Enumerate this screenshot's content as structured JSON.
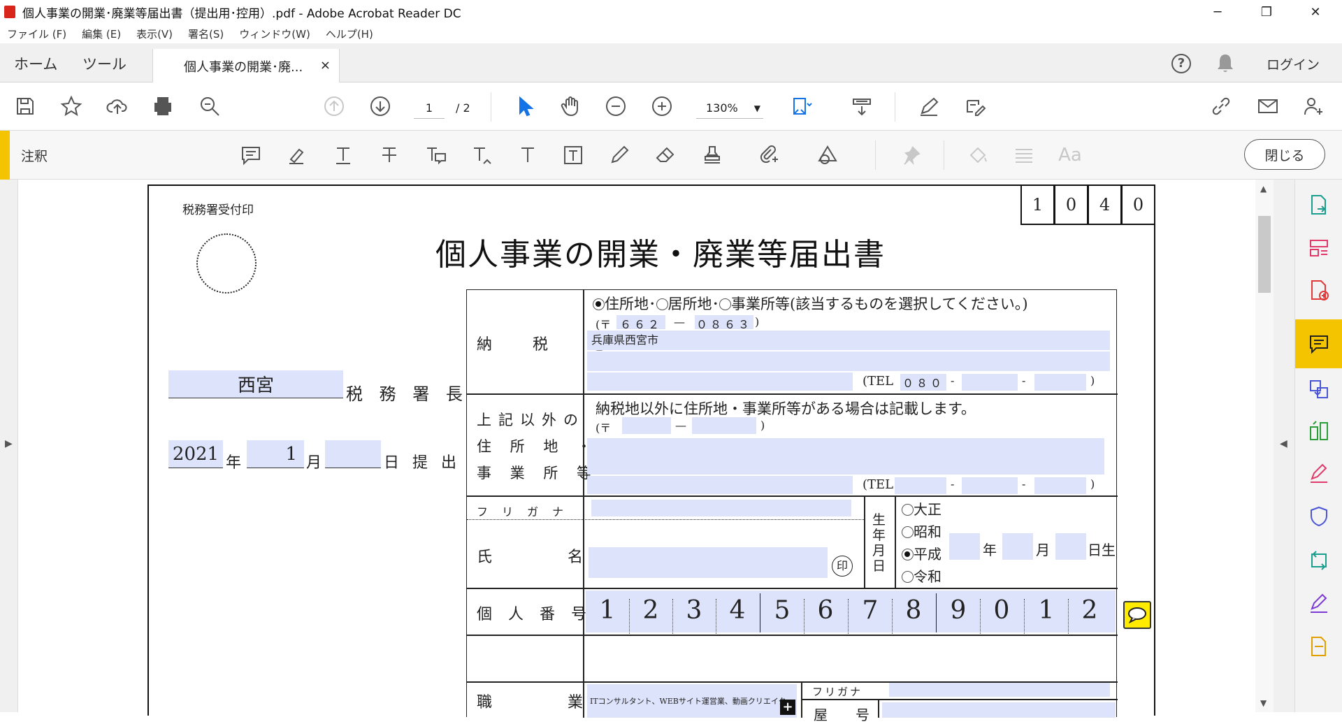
{
  "window": {
    "title": "個人事業の開業･廃業等届出書（提出用･控用）.pdf - Adobe Acrobat Reader DC",
    "minimize": "─",
    "maximize": "❐",
    "close": "✕"
  },
  "menu": [
    "ファイル (F)",
    "編集 (E)",
    "表示(V)",
    "署名(S)",
    "ウィンドウ(W)",
    "ヘルプ(H)"
  ],
  "tabs": {
    "home": "ホーム",
    "tools": "ツール",
    "doc": "個人事業の開業･廃...",
    "doc_close": "×",
    "login": "ログイン"
  },
  "toolbar": {
    "page_current": "1",
    "page_total": "/ 2",
    "zoom": "130%"
  },
  "comment_bar": {
    "label": "注釈",
    "close": "閉じる"
  },
  "form": {
    "stamp_label": "税務署受付印",
    "title": "個人事業の開業・廃業等届出書",
    "code_digits": [
      "1",
      "0",
      "4",
      "0"
    ],
    "tax_office_value": "西宮",
    "tax_office_label": "税 務 署 長",
    "date_year": "2021",
    "date_year_l": "年",
    "date_month": "1",
    "date_month_l": "月",
    "date_day": "",
    "date_day_l": "日 提 出",
    "row1_label": "納　税　地",
    "addr_opts": "住所地･　居所地･　事業所等(該当するものを選択してください。)",
    "addr_opt1": "住所地･",
    "addr_opt2": "居所地･",
    "addr_opt3": "事業所等(該当するものを選択してください。)",
    "postal_prefix": "(〒",
    "postal1": "６６２",
    "postal_dash": "—",
    "postal2": "０８６３",
    "postal_suffix": ")",
    "address": "兵庫県西宮市",
    "tel_label": "(TEL",
    "tel1": "０８０",
    "tel_dash": "-",
    "tel_end": ")",
    "row2_label_1": "上記以外の",
    "row2_label_2": "住 所 地 ・",
    "row2_label_3": "事 業 所 等",
    "row2_note": "納税地以外に住所地・事業所等がある場合は記載します。",
    "furigana_label": "フ　リ　ガ　ナ",
    "name_label": "氏　　　　名",
    "seal": "印",
    "birth_label": "生年月日",
    "era1": "大正",
    "era2": "昭和",
    "era3": "平成",
    "era4": "令和",
    "y_l": "年",
    "m_l": "月",
    "d_l": "日生",
    "mynumber_label": "個 人 番 号",
    "mynumber": [
      "1",
      "2",
      "3",
      "4",
      "5",
      "6",
      "7",
      "8",
      "9",
      "0",
      "1",
      "2"
    ],
    "job_label": "職　　　　業",
    "job_value": "ITコンサルタント、WEBサイト運営業、動画クリエイター",
    "trade_furigana": "フリガナ",
    "trade_label": "屋　　号"
  },
  "colors": {
    "accent": "#f5c400",
    "field": "#dde3fb",
    "blue": "#1473e6"
  }
}
